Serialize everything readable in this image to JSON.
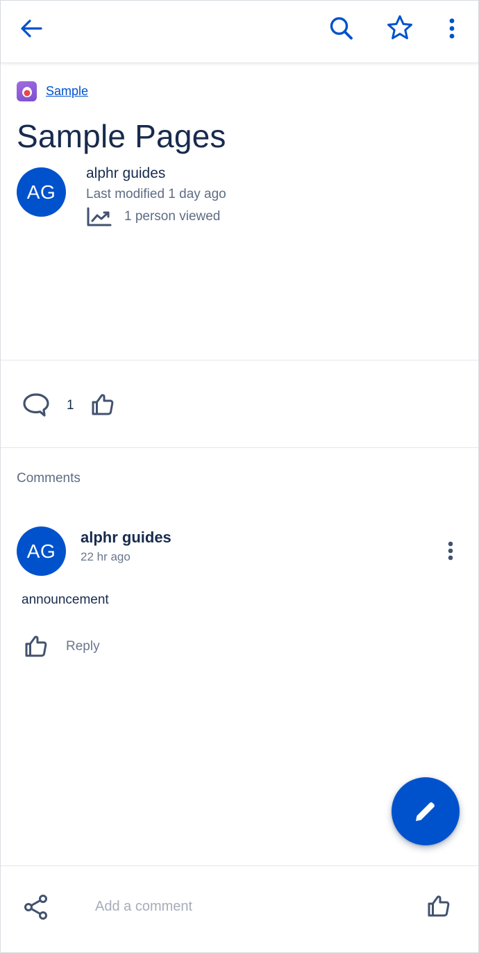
{
  "colors": {
    "primary": "#0052cc",
    "text": "#172b4d",
    "subtle": "#5e6c84",
    "placeholder": "#a5adba"
  },
  "topbar": {
    "icons": [
      "arrow-left-icon",
      "search-icon",
      "star-icon",
      "more-vertical-icon"
    ]
  },
  "breadcrumb": {
    "space_name": "Sample"
  },
  "page": {
    "title": "Sample Pages",
    "author": {
      "initials": "AG",
      "name": "alphr guides"
    },
    "last_modified": "Last modified 1 day ago",
    "views": "1 person viewed"
  },
  "reactions": {
    "comment_count": "1"
  },
  "comments": {
    "section_label": "Comments",
    "items": [
      {
        "initials": "AG",
        "author": "alphr guides",
        "time": "22 hr ago",
        "body": "announcement",
        "reply_label": "Reply"
      }
    ]
  },
  "bottom_bar": {
    "placeholder": "Add a comment"
  }
}
